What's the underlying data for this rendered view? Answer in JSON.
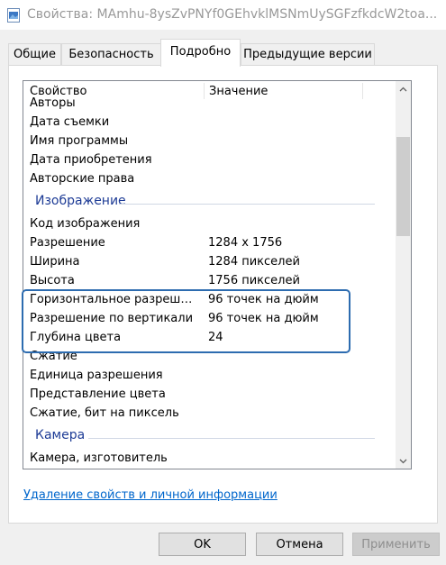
{
  "window": {
    "title": "Свойства: MAmhu-8ysZvPNYf0GEhvklMSNmUySGFzfkdcW2toa..."
  },
  "tabs": [
    {
      "label": "Общие"
    },
    {
      "label": "Безопасность"
    },
    {
      "label": "Подробно",
      "active": true
    },
    {
      "label": "Предыдущие версии"
    }
  ],
  "list": {
    "header": {
      "property": "Свойство",
      "value": "Значение"
    },
    "rows_top": [
      {
        "property": "Авторы",
        "value": ""
      },
      {
        "property": "Дата съемки",
        "value": ""
      },
      {
        "property": "Имя программы",
        "value": ""
      },
      {
        "property": "Дата приобретения",
        "value": ""
      },
      {
        "property": "Авторские права",
        "value": ""
      }
    ],
    "group_image": "Изображение",
    "rows_image": [
      {
        "property": "Код изображения",
        "value": ""
      },
      {
        "property": "Разрешение",
        "value": "1284 x 1756"
      },
      {
        "property": "Ширина",
        "value": "1284 пикселей"
      },
      {
        "property": "Высота",
        "value": "1756 пикселей"
      },
      {
        "property": "Горизонтальное разрешение",
        "value": "96 точек на дюйм"
      },
      {
        "property": "Разрешение по вертикали",
        "value": "96 точек на дюйм"
      },
      {
        "property": "Глубина цвета",
        "value": "24"
      },
      {
        "property": "Сжатие",
        "value": ""
      },
      {
        "property": "Единица разрешения",
        "value": ""
      },
      {
        "property": "Представление цвета",
        "value": ""
      },
      {
        "property": "Сжатие, бит на пиксель",
        "value": ""
      }
    ],
    "group_camera": "Камера",
    "rows_camera": [
      {
        "property": "Камера, изготовитель",
        "value": ""
      }
    ]
  },
  "remove_link": "Удаление свойств и личной информации",
  "buttons": {
    "ok": "OK",
    "cancel": "Отмена",
    "apply": "Применить"
  },
  "colors": {
    "accent": "#0066cc",
    "highlight_border": "#2d6cb0",
    "group_text": "#1e3c96"
  }
}
